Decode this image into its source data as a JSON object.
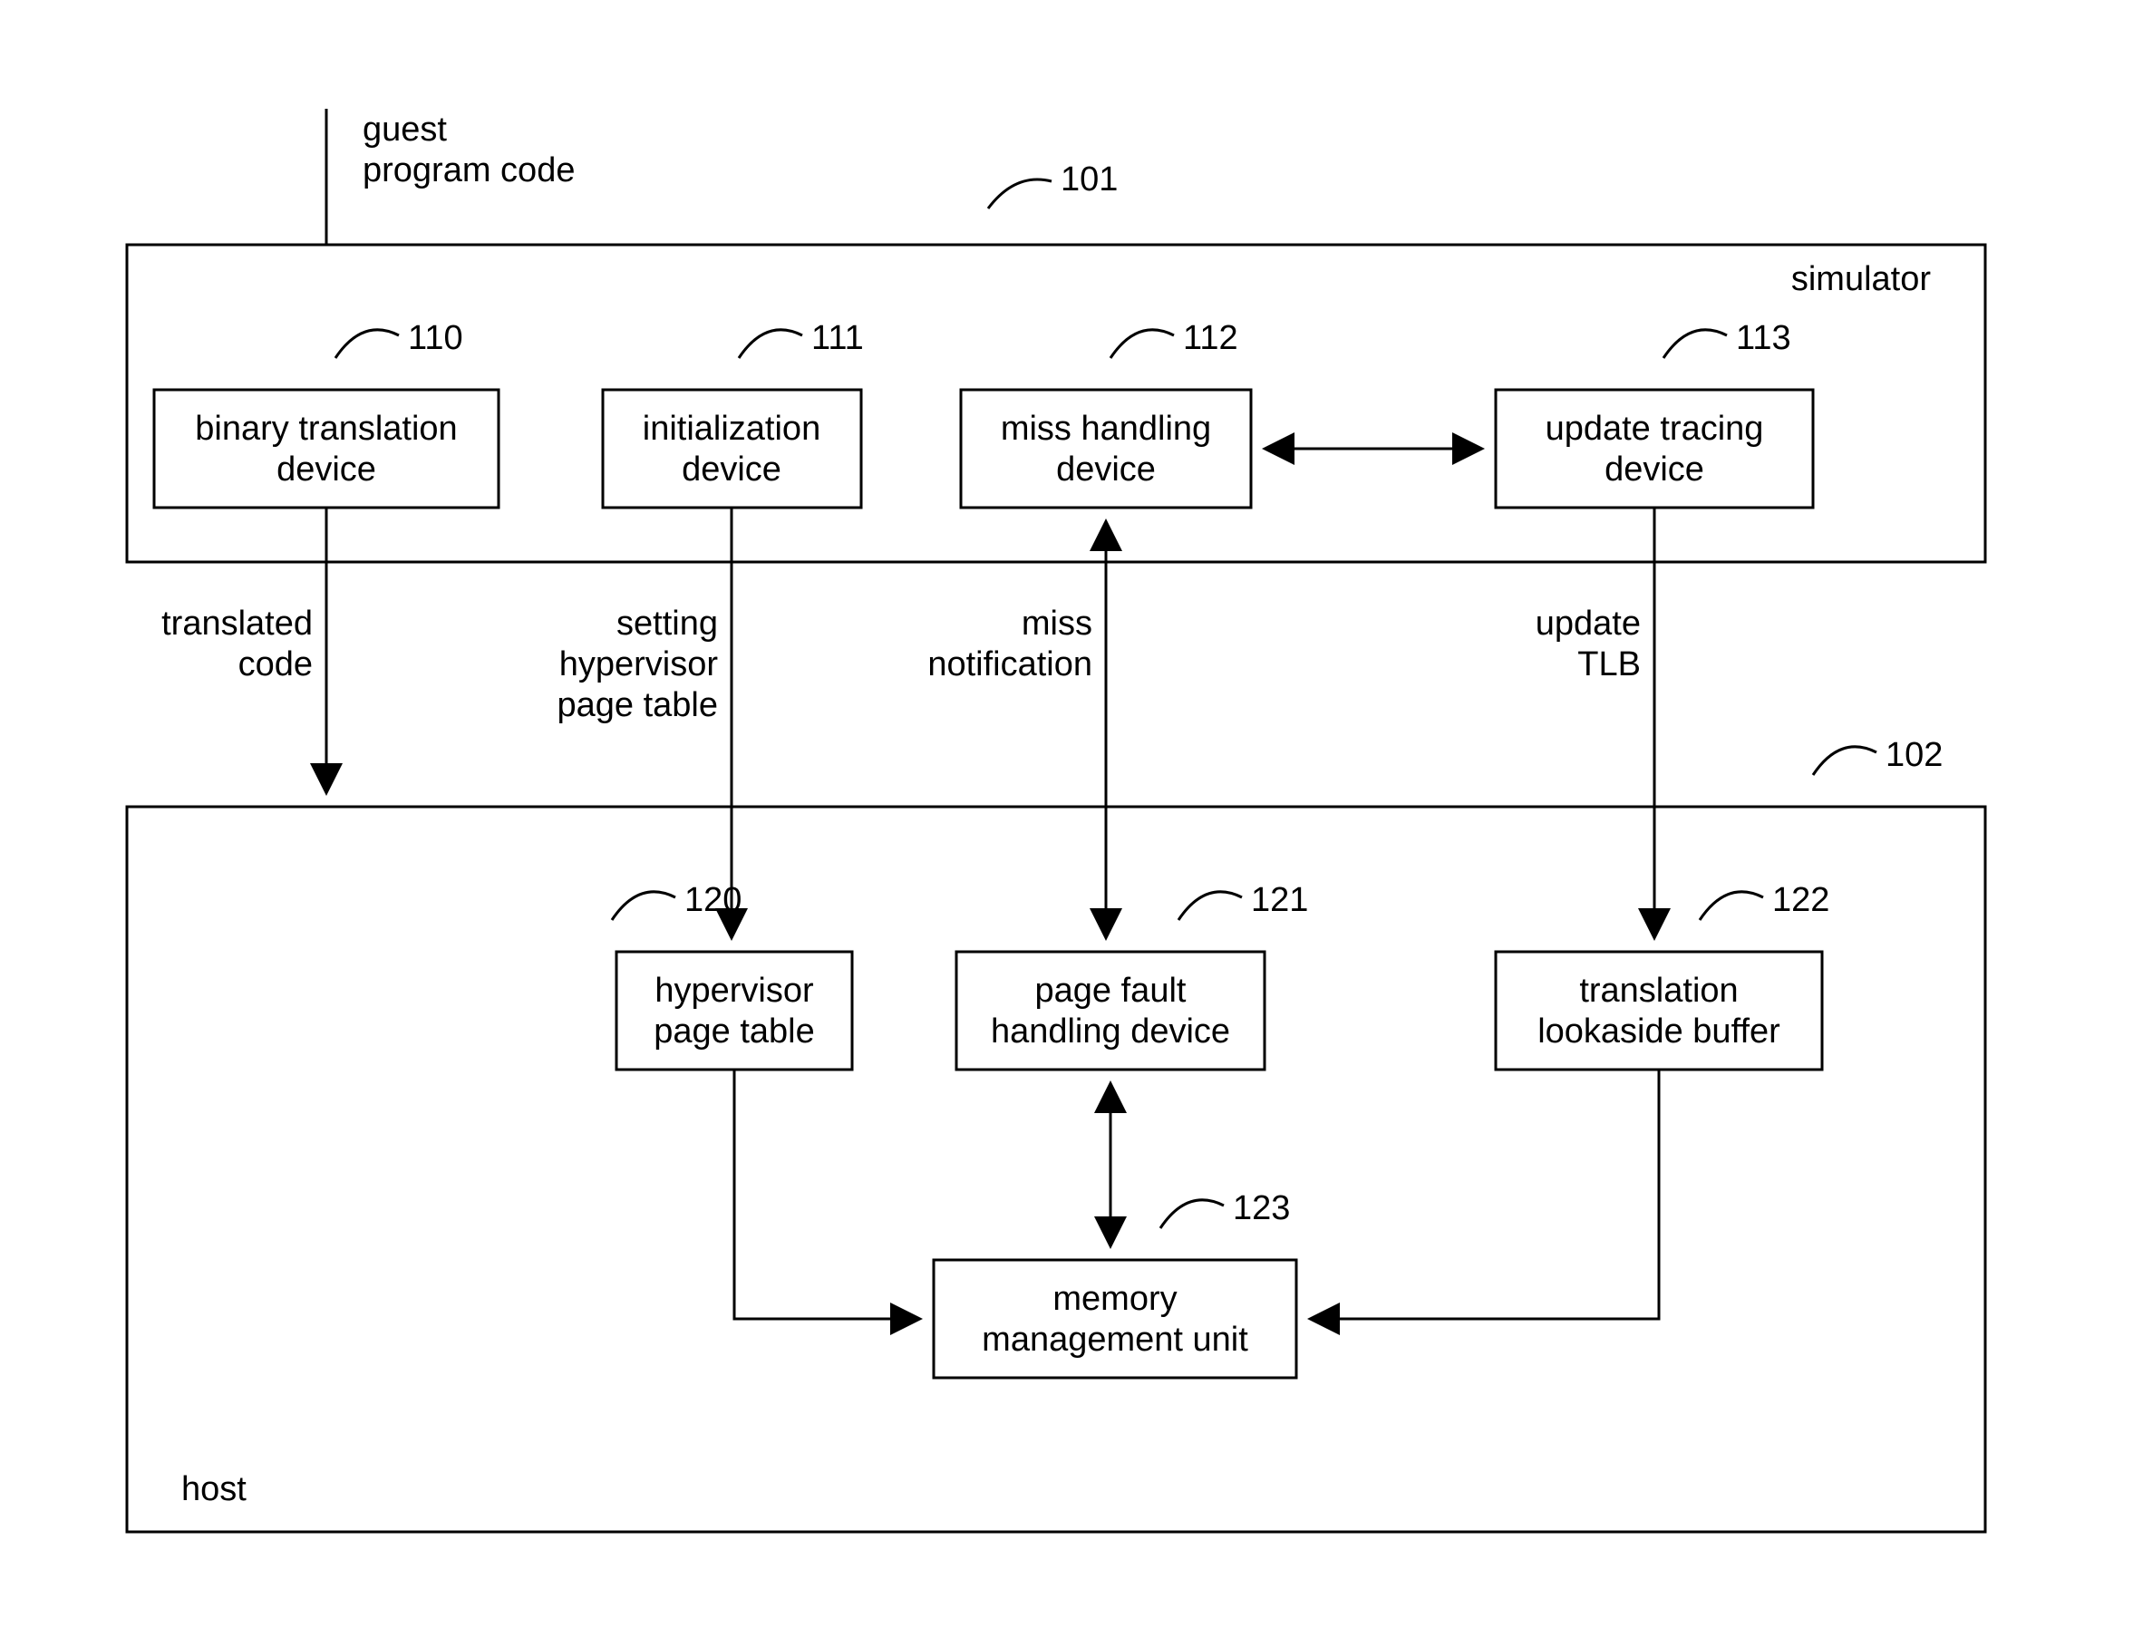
{
  "outside": {
    "input_label_l1": "guest",
    "input_label_l2": "program code"
  },
  "simulator": {
    "ref": "101",
    "title": "simulator",
    "boxes": {
      "b110": {
        "ref": "110",
        "l1": "binary translation",
        "l2": "device"
      },
      "b111": {
        "ref": "111",
        "l1": "initialization",
        "l2": "device"
      },
      "b112": {
        "ref": "112",
        "l1": "miss handling",
        "l2": "device"
      },
      "b113": {
        "ref": "113",
        "l1": "update tracing",
        "l2": "device"
      }
    }
  },
  "arrows": {
    "a1_l1": "translated",
    "a1_l2": "code",
    "a2_l1": "setting",
    "a2_l2": "hypervisor",
    "a2_l3": "page table",
    "a3_l1": "miss",
    "a3_l2": "notification",
    "a4_l1": "update",
    "a4_l2": "TLB"
  },
  "host": {
    "ref": "102",
    "title": "host",
    "boxes": {
      "b120": {
        "ref": "120",
        "l1": "hypervisor",
        "l2": "page table"
      },
      "b121": {
        "ref": "121",
        "l1": "page fault",
        "l2": "handling device"
      },
      "b122": {
        "ref": "122",
        "l1": "translation",
        "l2": "lookaside buffer"
      },
      "b123": {
        "ref": "123",
        "l1": "memory",
        "l2": "management unit"
      }
    }
  }
}
